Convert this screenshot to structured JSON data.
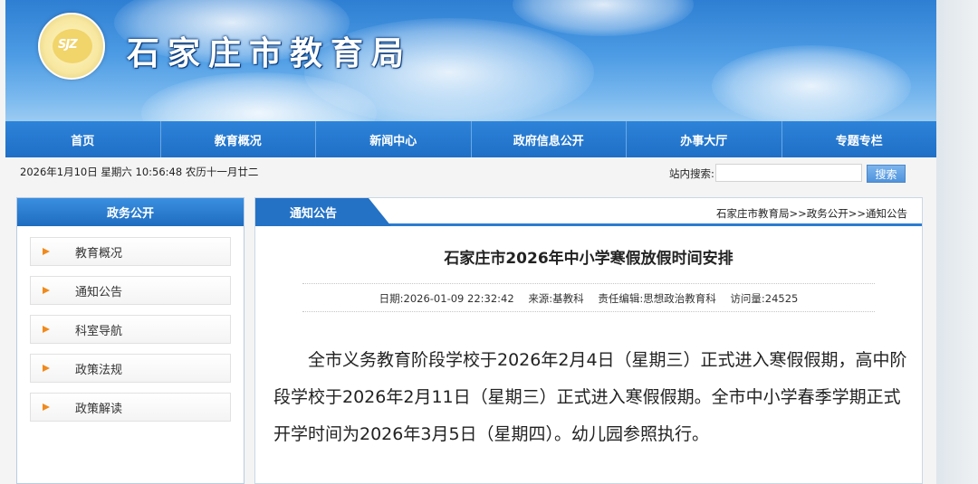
{
  "site": {
    "title": "石家庄市教育局",
    "logo_icon": "bureau-emblem-icon"
  },
  "nav": {
    "items": [
      "首页",
      "教育概况",
      "新闻中心",
      "政府信息公开",
      "办事大厅",
      "专题专栏"
    ]
  },
  "infobar": {
    "datetime": "2026年1月10日 星期六 10:56:48 农历十一月廿二",
    "search_label": "站内搜索:",
    "search_placeholder": "",
    "search_button": "搜索"
  },
  "sidebar": {
    "header": "政务公开",
    "items": [
      {
        "label": "教育概况"
      },
      {
        "label": "通知公告"
      },
      {
        "label": "科室导航"
      },
      {
        "label": "政策法规"
      },
      {
        "label": "政策解读"
      }
    ]
  },
  "main": {
    "tab": "通知公告",
    "breadcrumb": "石家庄市教育局>>政务公开>>通知公告",
    "title": "石家庄市2026年中小学寒假放假时间安排",
    "meta": {
      "date": "日期:2026-01-09 22:32:42",
      "source": "来源:基教科",
      "editor": "责任编辑:思想政治教育科",
      "views": "访问量:24525"
    },
    "body": "全市义务教育阶段学校于2026年2月4日（星期三）正式进入寒假假期，高中阶段学校于2026年2月11日（星期三）正式进入寒假假期。全市中小学春季学期正式开学时间为2026年3月5日（星期四）。幼儿园参照执行。"
  },
  "colors": {
    "nav_blue": "#1f6fc6",
    "accent_orange": "#f08a1c"
  }
}
